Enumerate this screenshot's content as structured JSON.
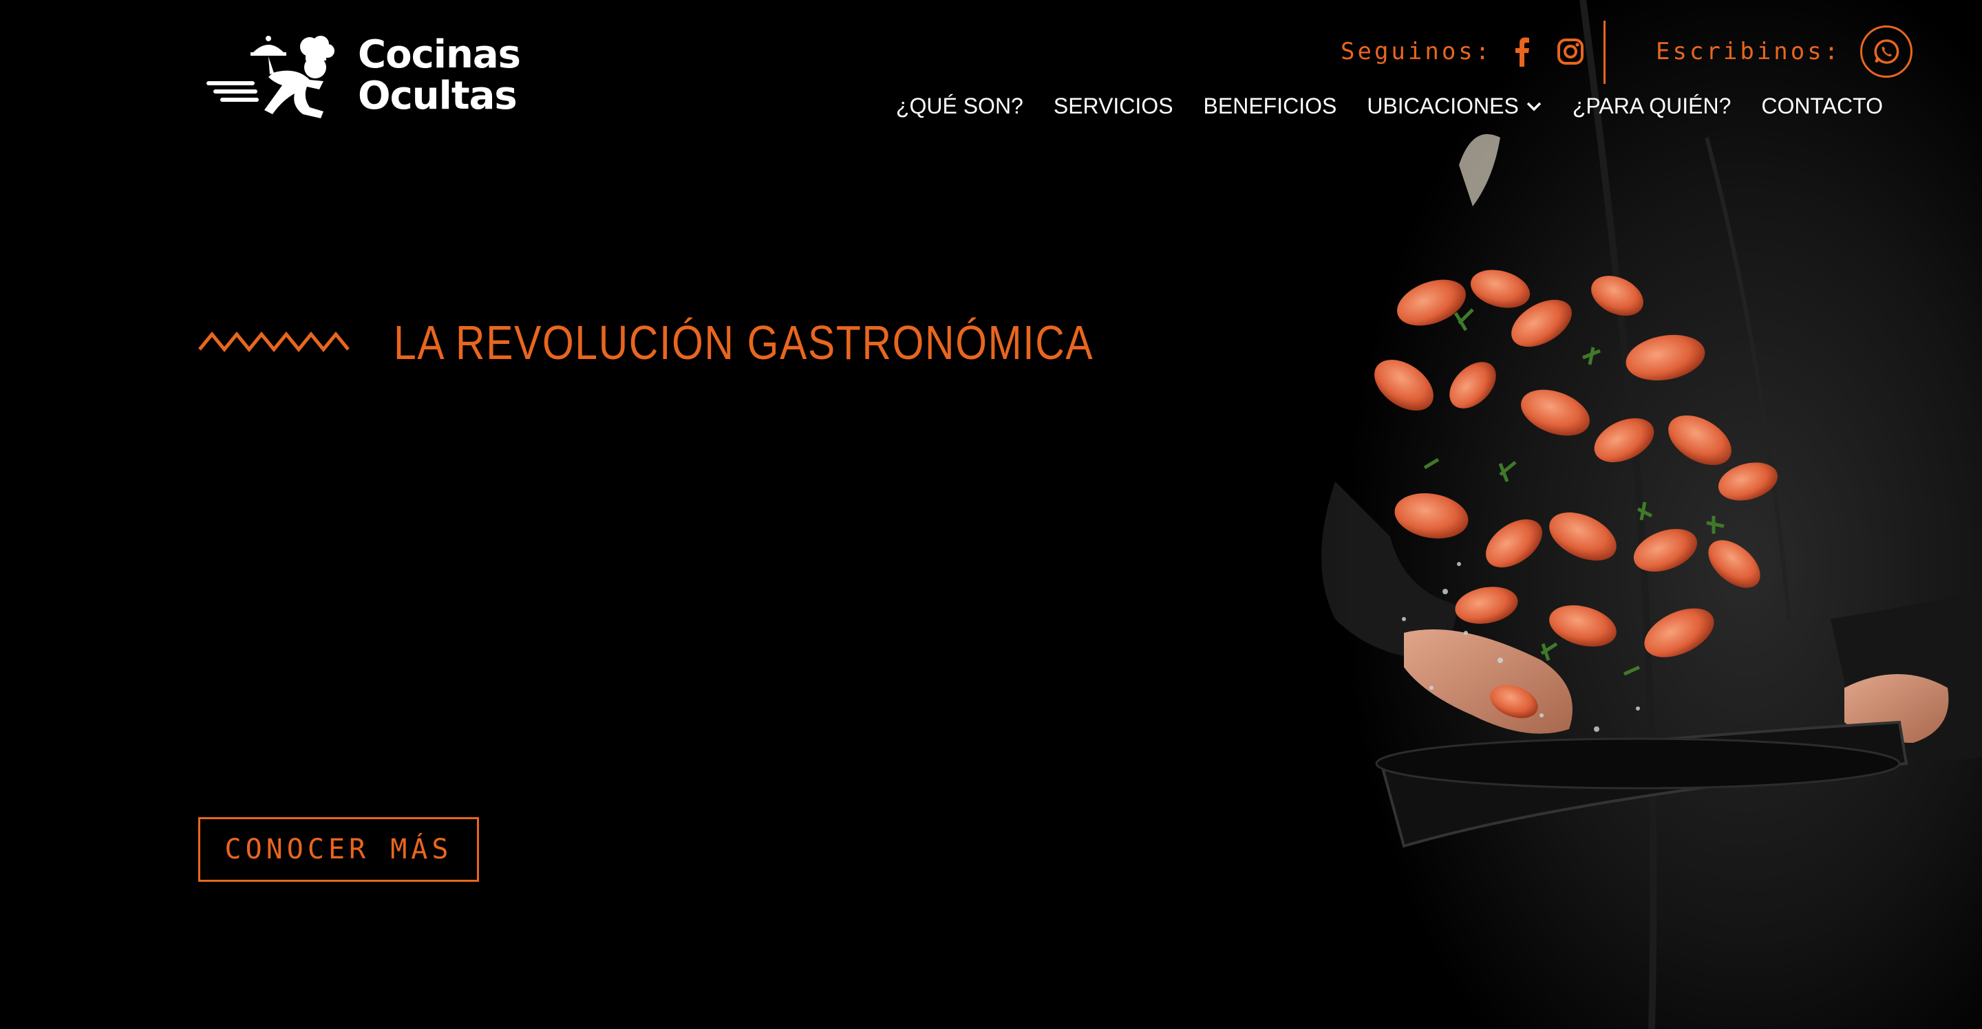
{
  "brand": {
    "name_line1": "Cocinas",
    "name_line2": "Ocultas"
  },
  "header": {
    "follow_label": "Seguinos:",
    "write_label": "Escribinos:",
    "social_icons": [
      "facebook-icon",
      "instagram-icon",
      "whatsapp-icon"
    ]
  },
  "nav": {
    "items": [
      {
        "label": "¿QUÉ SON?"
      },
      {
        "label": "SERVICIOS"
      },
      {
        "label": "BENEFICIOS"
      },
      {
        "label": "UBICACIONES",
        "has_dropdown": true
      },
      {
        "label": "¿PARA QUIÉN?"
      },
      {
        "label": "CONTACTO"
      }
    ]
  },
  "hero": {
    "tagline": "LA REVOLUCIÓN GASTRONÓMICA",
    "cta_label": "CONOCER MÁS",
    "image_description_icon": "chef-tossing-shrimp-pan-photo"
  },
  "colors": {
    "accent": "#e8661f",
    "background": "#000000",
    "text": "#ffffff"
  }
}
